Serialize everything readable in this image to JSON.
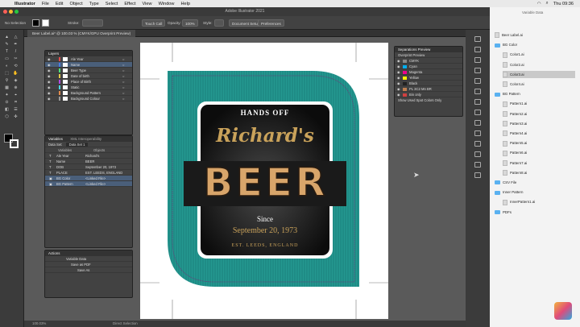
{
  "menubar": {
    "app": "Illustrator",
    "items": [
      "File",
      "Edit",
      "Object",
      "Type",
      "Select",
      "Effect",
      "View",
      "Window",
      "Help"
    ],
    "clock": "Thu 09:36"
  },
  "window": {
    "title": "Adobe Illustrator 2021"
  },
  "control": {
    "selection": "No Selection",
    "stroke_label": "Stroke:",
    "touch": "Touch Call",
    "opacity_label": "Opacity:",
    "opacity": "100%",
    "style_label": "Style:",
    "doc_setup": "Document Setup",
    "preferences": "Preferences"
  },
  "document": {
    "tab": "Beer Label.ai* @ 100.03 % (CMYK/GPU Overprint Preview)"
  },
  "layers": {
    "title": "Layers",
    "items": [
      "Ale Year",
      "Name",
      "Beer Type",
      "Date of birth",
      "Place of Birth",
      "Static",
      "Background Pattern",
      "Background Colour"
    ],
    "count": "8 Layers"
  },
  "variables": {
    "tab1": "Variables",
    "tab2": "XML Interoperability",
    "data_set_label": "Data Set:",
    "data_set": "Data Set 1",
    "col_var": "Variables",
    "col_obj": "Objects",
    "rows": [
      [
        "Ale Year",
        "Richard's"
      ],
      [
        "Name",
        "BEER"
      ],
      [
        "DOB",
        "September 20, 1973"
      ],
      [
        "PLACE",
        "EST. LEEDS, ENGLAND"
      ],
      [
        "BG Color",
        "<Linked File>"
      ],
      [
        "BG Pattern",
        "<Linked File>"
      ]
    ]
  },
  "actions": {
    "title": "Actions",
    "items": [
      "Variable Data",
      "Save as PDF",
      "Save As"
    ]
  },
  "separations": {
    "title": "Separations Preview",
    "overprint": "Overprint Preview",
    "items": [
      "CMYK",
      "Cyan",
      "Magenta",
      "Yellow",
      "Black",
      "PL 3C2 Mn BR",
      "Bin only"
    ],
    "footer": "Show Used Spot Colors Only"
  },
  "label": {
    "hands_off": "HANDS OFF",
    "name": "Richard's",
    "beer": "BEER",
    "since": "Since",
    "date": "September 20, 1973",
    "est": "EST. LEEDS, ENGLAND",
    "teal": "#1f8c86",
    "gold": "#c9a25a"
  },
  "finder": {
    "title": "Variable Data",
    "items": [
      {
        "name": "Beer Label.ai",
        "kind": "file",
        "indent": 0
      },
      {
        "name": "BG Color",
        "kind": "folder",
        "indent": 0
      },
      {
        "name": "Color1.ai",
        "kind": "file",
        "indent": 1
      },
      {
        "name": "Color2.ai",
        "kind": "file",
        "indent": 1
      },
      {
        "name": "Color3.ai",
        "kind": "file",
        "indent": 1
      },
      {
        "name": "Color4.ai",
        "kind": "file",
        "indent": 1
      },
      {
        "name": "BG Pattern",
        "kind": "folder",
        "indent": 0
      },
      {
        "name": "Pattern1.ai",
        "kind": "file",
        "indent": 1
      },
      {
        "name": "Pattern2.ai",
        "kind": "file",
        "indent": 1
      },
      {
        "name": "Pattern3.ai",
        "kind": "file",
        "indent": 1
      },
      {
        "name": "Pattern4.ai",
        "kind": "file",
        "indent": 1
      },
      {
        "name": "Pattern5.ai",
        "kind": "file",
        "indent": 1
      },
      {
        "name": "Pattern6.ai",
        "kind": "file",
        "indent": 1
      },
      {
        "name": "Pattern7.ai",
        "kind": "file",
        "indent": 1
      },
      {
        "name": "Pattern8.ai",
        "kind": "file",
        "indent": 1
      },
      {
        "name": "CSV File",
        "kind": "folder",
        "indent": 0
      },
      {
        "name": "Inner Pattern",
        "kind": "folder",
        "indent": 0
      },
      {
        "name": "InnerPattern1.ai",
        "kind": "file",
        "indent": 1
      },
      {
        "name": "PDFs",
        "kind": "folder",
        "indent": 0
      }
    ]
  },
  "status": {
    "zoom": "100.03%",
    "info": "Direct Selection"
  },
  "icons": [
    "apple-icon",
    "selection-tool-icon",
    "direct-selection-tool-icon",
    "pen-tool-icon",
    "type-tool-icon",
    "rectangle-tool-icon",
    "eye-icon",
    "cursor-icon",
    "folder-icon",
    "file-icon"
  ]
}
